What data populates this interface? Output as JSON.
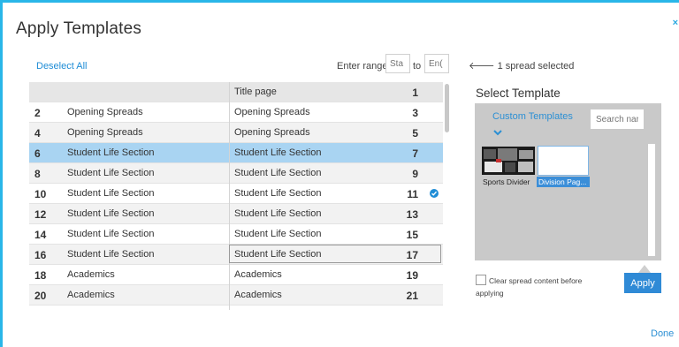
{
  "dialog": {
    "title": "Apply Templates",
    "close_glyph": "×"
  },
  "left": {
    "deselect_label": "Deselect All",
    "range_label": "Enter range:",
    "range_start_placeholder": "Sta",
    "range_to": "to",
    "range_end_placeholder": "En(",
    "rows": [
      {
        "left_num": "",
        "left_title": "",
        "right_title": "Title page",
        "right_num": "1"
      },
      {
        "left_num": "2",
        "left_title": "Opening Spreads",
        "right_title": "Opening Spreads",
        "right_num": "3"
      },
      {
        "left_num": "4",
        "left_title": "Opening Spreads",
        "right_title": "Opening Spreads",
        "right_num": "5"
      },
      {
        "left_num": "6",
        "left_title": "Student Life Section",
        "right_title": "Student Life Section",
        "right_num": "7"
      },
      {
        "left_num": "8",
        "left_title": "Student Life Section",
        "right_title": "Student Life Section",
        "right_num": "9"
      },
      {
        "left_num": "10",
        "left_title": "Student Life Section",
        "right_title": "Student Life Section",
        "right_num": "11"
      },
      {
        "left_num": "12",
        "left_title": "Student Life Section",
        "right_title": "Student Life Section",
        "right_num": "13"
      },
      {
        "left_num": "14",
        "left_title": "Student Life Section",
        "right_title": "Student Life Section",
        "right_num": "15"
      },
      {
        "left_num": "16",
        "left_title": "Student Life Section",
        "right_title": "Student Life Section",
        "right_num": "17"
      },
      {
        "left_num": "18",
        "left_title": "Academics",
        "right_title": "Academics",
        "right_num": "19"
      },
      {
        "left_num": "20",
        "left_title": "Academics",
        "right_title": "Academics",
        "right_num": "21"
      }
    ]
  },
  "right": {
    "spread_selected": "1 spread selected",
    "select_title": "Select Template",
    "dropdown_label": "Custom Templates",
    "search_placeholder": "Search nar",
    "templates": [
      {
        "label": "Sports Divider"
      },
      {
        "label": "Division Pag..."
      }
    ],
    "clear_line1": "Clear spread content before",
    "clear_line2": "applying",
    "apply_label": "Apply"
  },
  "footer": {
    "done_label": "Done"
  },
  "colors": {
    "accent": "#29b6e8",
    "selected_row": "#a9d4f2",
    "button": "#2f8ad6"
  }
}
